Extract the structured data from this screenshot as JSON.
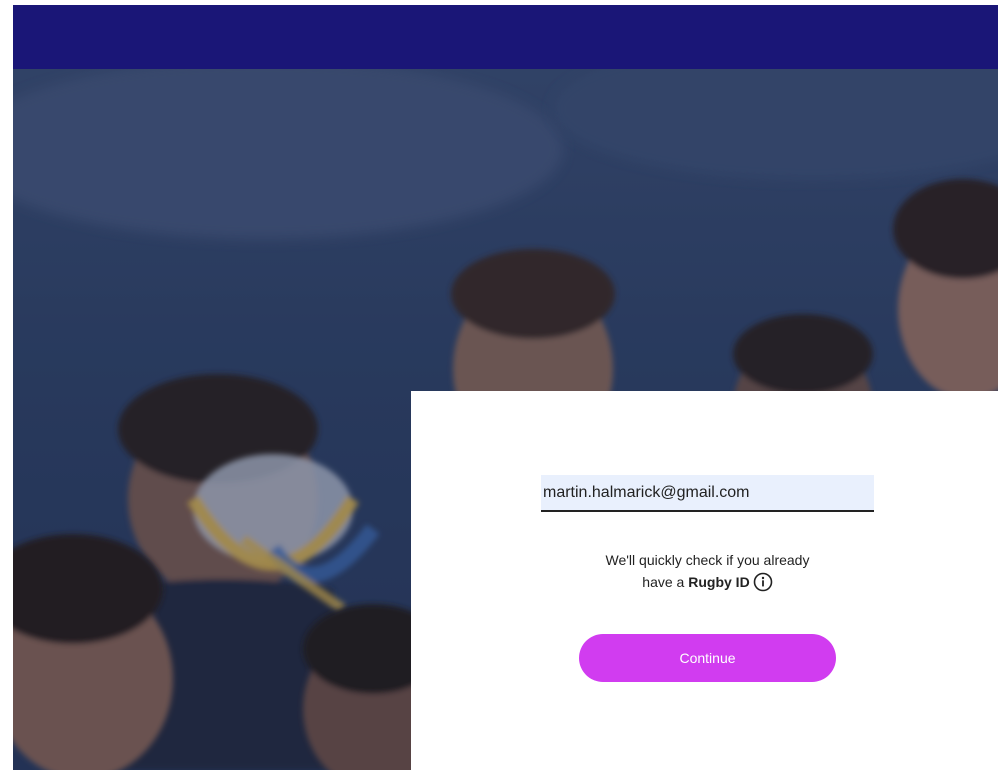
{
  "colors": {
    "header": "#1a1677",
    "hero_tint": "#2e4366",
    "card": "#ffffff",
    "field_bg": "#e9f0fd",
    "field_underline": "#222222",
    "button": "#d13cf0",
    "button_text": "#ffffff"
  },
  "form": {
    "email_value": "martin.halmarick@gmail.com",
    "hint_line1": "We'll quickly check if you already",
    "hint_line2_prefix": "have a ",
    "hint_brand": "Rugby ID",
    "info_icon": "info-circle-icon",
    "continue_label": "Continue"
  }
}
